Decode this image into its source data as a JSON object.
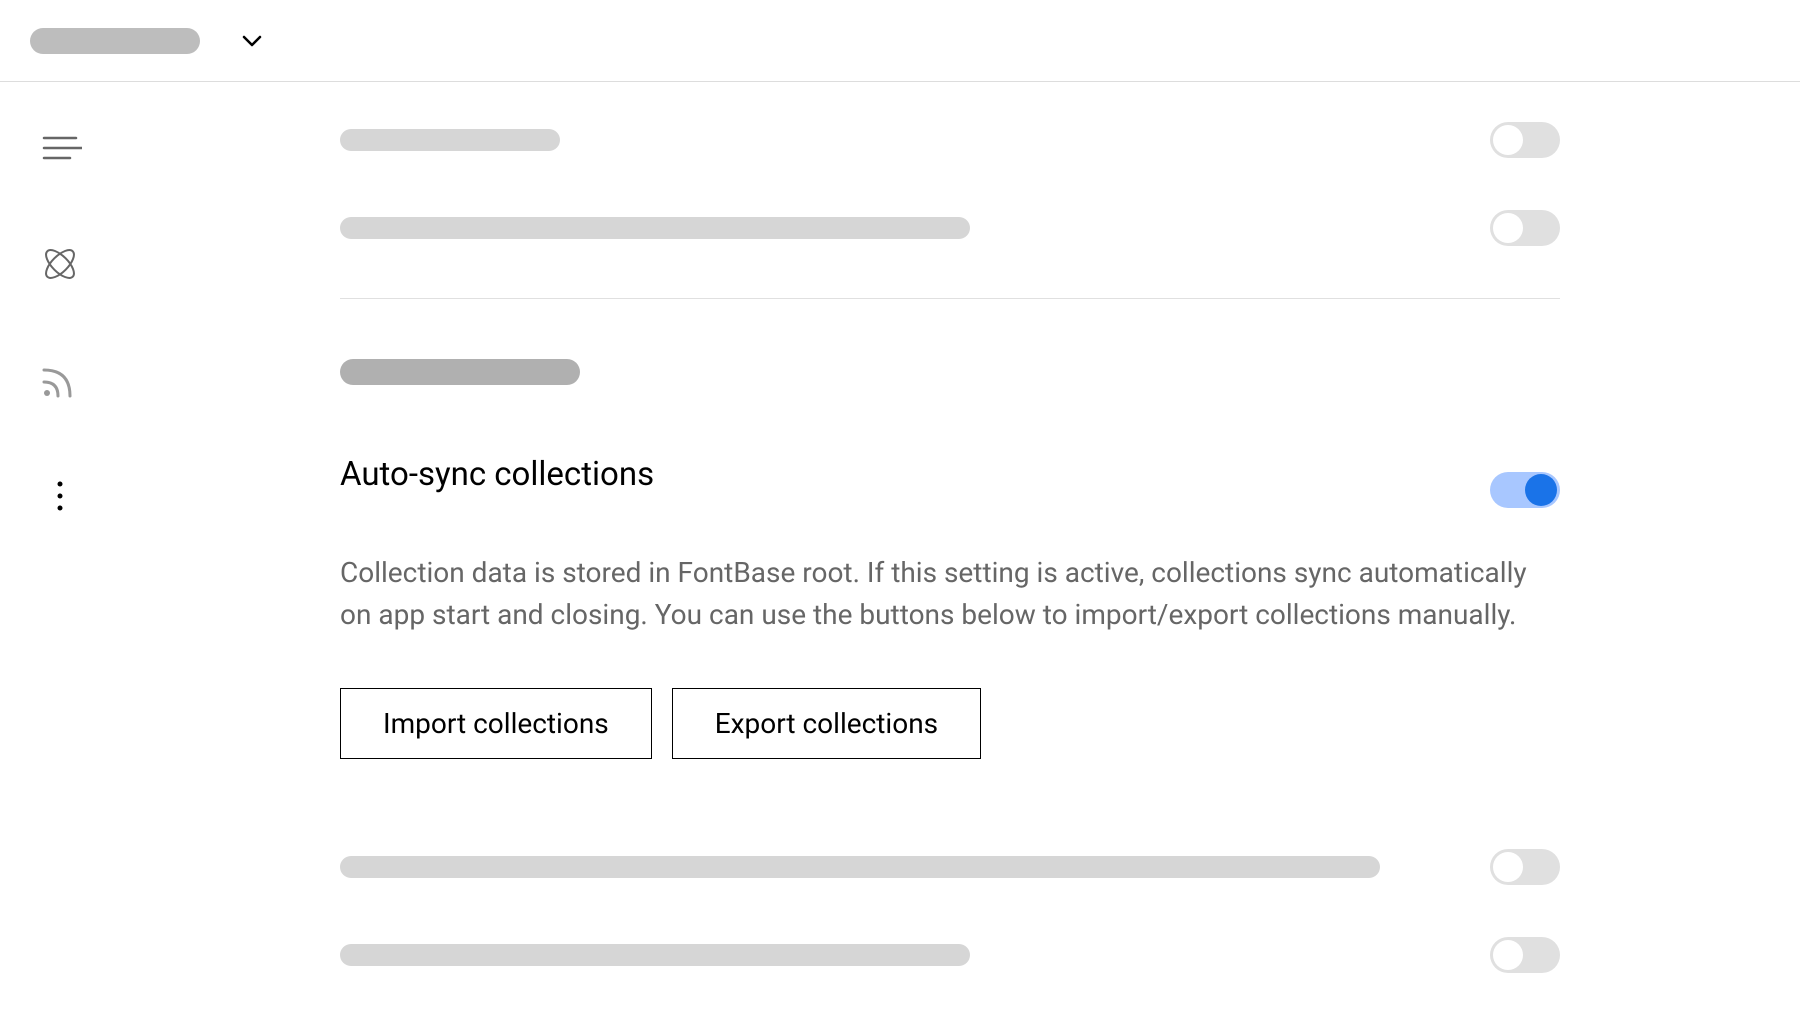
{
  "header": {
    "dropdown_placeholder": ""
  },
  "settings": {
    "auto_sync": {
      "title": "Auto-sync collections",
      "description": "Collection data is stored in FontBase root. If this setting is active, collections sync automatically on app start and closing. You can use the buttons below to import/export collections manually.",
      "enabled": true
    },
    "import_button": "Import collections",
    "export_button": "Export collections"
  }
}
